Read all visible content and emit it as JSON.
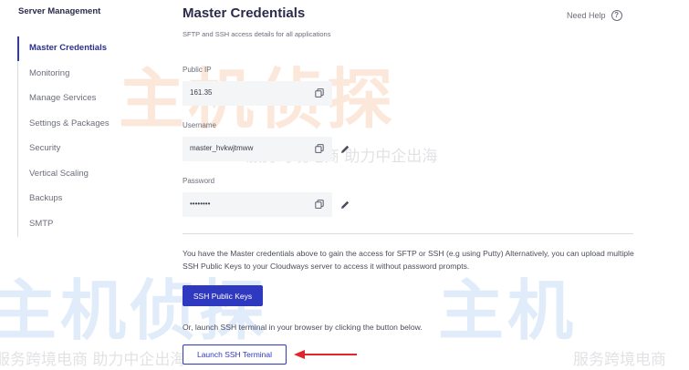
{
  "sidebar": {
    "title": "Server Management",
    "items": [
      {
        "label": "Master Credentials",
        "active": true
      },
      {
        "label": "Monitoring"
      },
      {
        "label": "Manage Services"
      },
      {
        "label": "Settings & Packages"
      },
      {
        "label": "Security"
      },
      {
        "label": "Vertical Scaling"
      },
      {
        "label": "Backups"
      },
      {
        "label": "SMTP"
      }
    ]
  },
  "header": {
    "title": "Master Credentials",
    "subtitle": "SFTP and SSH access details for all applications",
    "help_label": "Need Help",
    "help_icon": "?"
  },
  "fields": {
    "public_ip": {
      "label": "Public IP",
      "value": "161.35"
    },
    "username": {
      "label": "Username",
      "value": "master_hvkwjtmww"
    },
    "password": {
      "label": "Password",
      "value": "••••••••"
    }
  },
  "info": {
    "ssh_keys_text": "You have the Master credentials above to gain the access for SFTP or SSH (e.g using Putty) Alternatively, you can upload multiple SSH Public Keys to your Cloudways server to access it without password prompts.",
    "ssh_keys_button": "SSH Public Keys",
    "terminal_text": "Or, launch SSH terminal in your browser by clicking the button below.",
    "terminal_button": "Launch SSH Terminal"
  },
  "watermark": {
    "big_1": "主机侦探",
    "small_1": "服务跨境电商 助力中企出海",
    "big_2": "主机侦探",
    "small_2": "服务跨境电商 助力中企出海",
    "big_3": "主机",
    "small_3": "服务跨境电商"
  },
  "colors": {
    "accent": "#2f39bf",
    "arrow": "#e0252b"
  }
}
